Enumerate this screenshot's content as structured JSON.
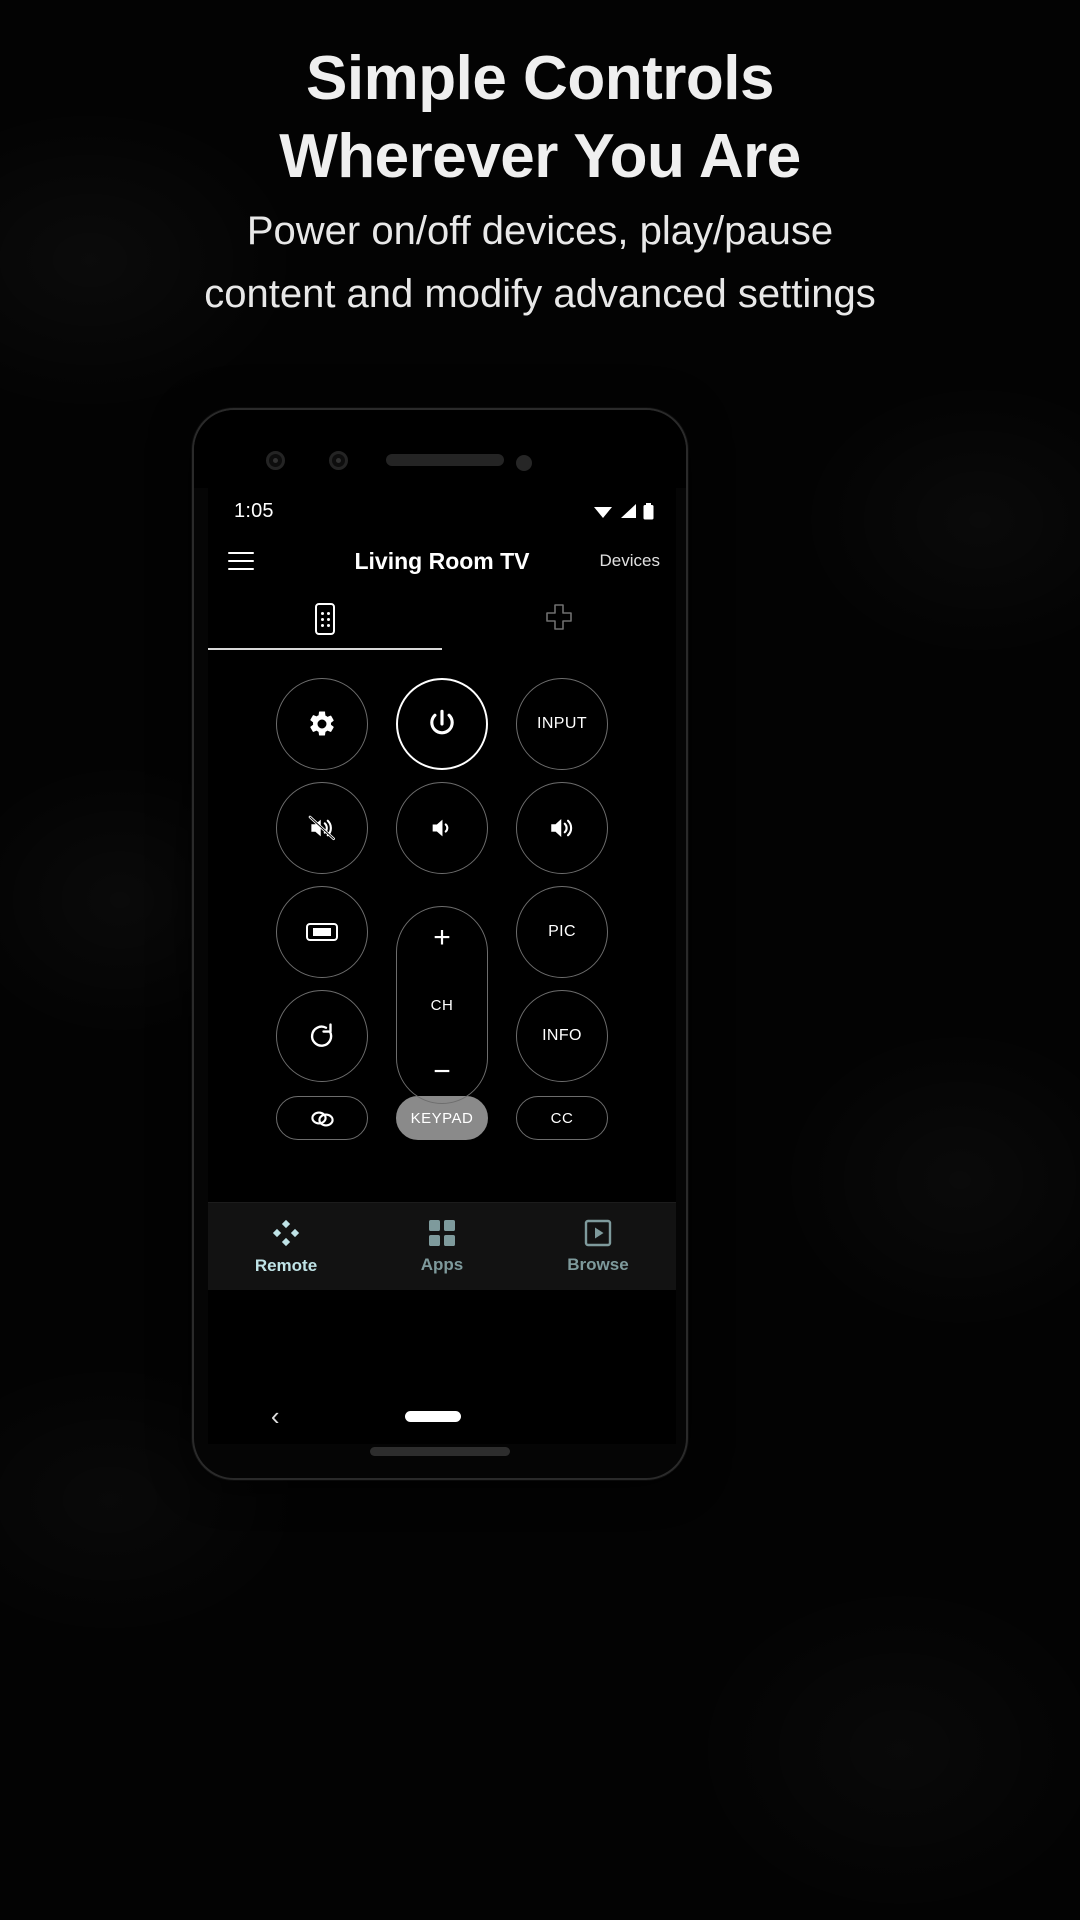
{
  "promo": {
    "headline_line1": "Simple Controls",
    "headline_line2": "Wherever You Are",
    "subline_line1": "Power on/off devices, play/pause",
    "subline_line2": "content and modify advanced settings"
  },
  "phone": {
    "statusbar": {
      "clock": "1:05",
      "icons": [
        "wifi-icon",
        "cellular-signal-icon",
        "battery-icon"
      ]
    },
    "appbar": {
      "menu_icon": "hamburger-menu-icon",
      "title": "Living Room TV",
      "action_label": "Devices"
    },
    "tabs": [
      {
        "id": "remote",
        "icon": "remote-control-icon",
        "active": true
      },
      {
        "id": "dpad",
        "icon": "dpad-icon",
        "active": false
      }
    ],
    "remote_buttons": {
      "row1": [
        {
          "name": "settings-button",
          "icon": "gear-icon",
          "label": "",
          "style": "outline"
        },
        {
          "name": "power-button",
          "icon": "power-icon",
          "label": "",
          "style": "power"
        },
        {
          "name": "input-button",
          "icon": "",
          "label": "INPUT",
          "style": "outline"
        }
      ],
      "row2": [
        {
          "name": "mute-button",
          "icon": "volume-mute-icon",
          "label": "",
          "style": "outline"
        },
        {
          "name": "volume-down-button",
          "icon": "volume-low-icon",
          "label": "",
          "style": "outline"
        },
        {
          "name": "volume-up-button",
          "icon": "volume-high-icon",
          "label": "",
          "style": "outline"
        }
      ],
      "row3": [
        {
          "name": "aspect-ratio-button",
          "icon": "aspect-ratio-icon",
          "label": "",
          "style": "outline"
        },
        {
          "name": "picture-button",
          "icon": "",
          "label": "PIC",
          "style": "outline"
        }
      ],
      "row4": [
        {
          "name": "rotate-button",
          "icon": "rotate-icon",
          "label": "",
          "style": "outline"
        },
        {
          "name": "info-button",
          "icon": "",
          "label": "INFO",
          "style": "outline"
        }
      ],
      "channel_rocker": {
        "name": "channel-rocker",
        "plus": "+",
        "label": "CH",
        "minus": "−"
      },
      "pills": [
        {
          "name": "link-button",
          "icon": "link-icon",
          "label": "",
          "style": "outline"
        },
        {
          "name": "keypad-button",
          "icon": "",
          "label": "KEYPAD",
          "style": "filled"
        },
        {
          "name": "closed-caption-button",
          "icon": "",
          "label": "CC",
          "style": "outline"
        }
      ]
    },
    "bottom_nav": [
      {
        "id": "remote",
        "label": "Remote",
        "icon": "dpad-nav-icon",
        "active": true
      },
      {
        "id": "apps",
        "label": "Apps",
        "icon": "grid-apps-icon",
        "active": false
      },
      {
        "id": "browse",
        "label": "Browse",
        "icon": "play-box-icon",
        "active": false
      }
    ],
    "system_nav": {
      "back": "back-chevron-icon",
      "home": "home-pill-indicator"
    }
  },
  "colors": {
    "accent_active": "#bfe3e6",
    "accent_inactive": "#7e9a9c",
    "outline": "#6d6d6d",
    "text": "#ffffff",
    "filled_pill": "#8a8a8a",
    "background": "#000000"
  }
}
